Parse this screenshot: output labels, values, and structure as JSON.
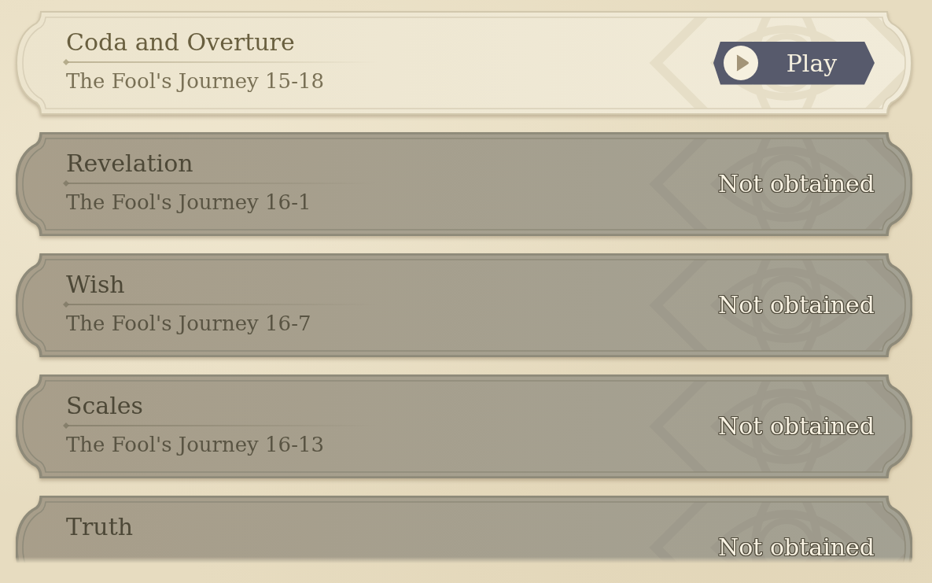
{
  "scenes": [
    {
      "title": "Coda and Overture",
      "subtitle": "The Fool's Journey 15-18",
      "obtained": true,
      "action": "Play"
    },
    {
      "title": "Revelation",
      "subtitle": "The Fool's Journey 16-1",
      "obtained": false,
      "status": "Not obtained"
    },
    {
      "title": "Wish",
      "subtitle": "The Fool's Journey 16-7",
      "obtained": false,
      "status": "Not obtained"
    },
    {
      "title": "Scales",
      "subtitle": "The Fool's Journey 16-13",
      "obtained": false,
      "status": "Not obtained"
    },
    {
      "title": "Truth",
      "obtained": false,
      "status": "Not obtained"
    }
  ]
}
